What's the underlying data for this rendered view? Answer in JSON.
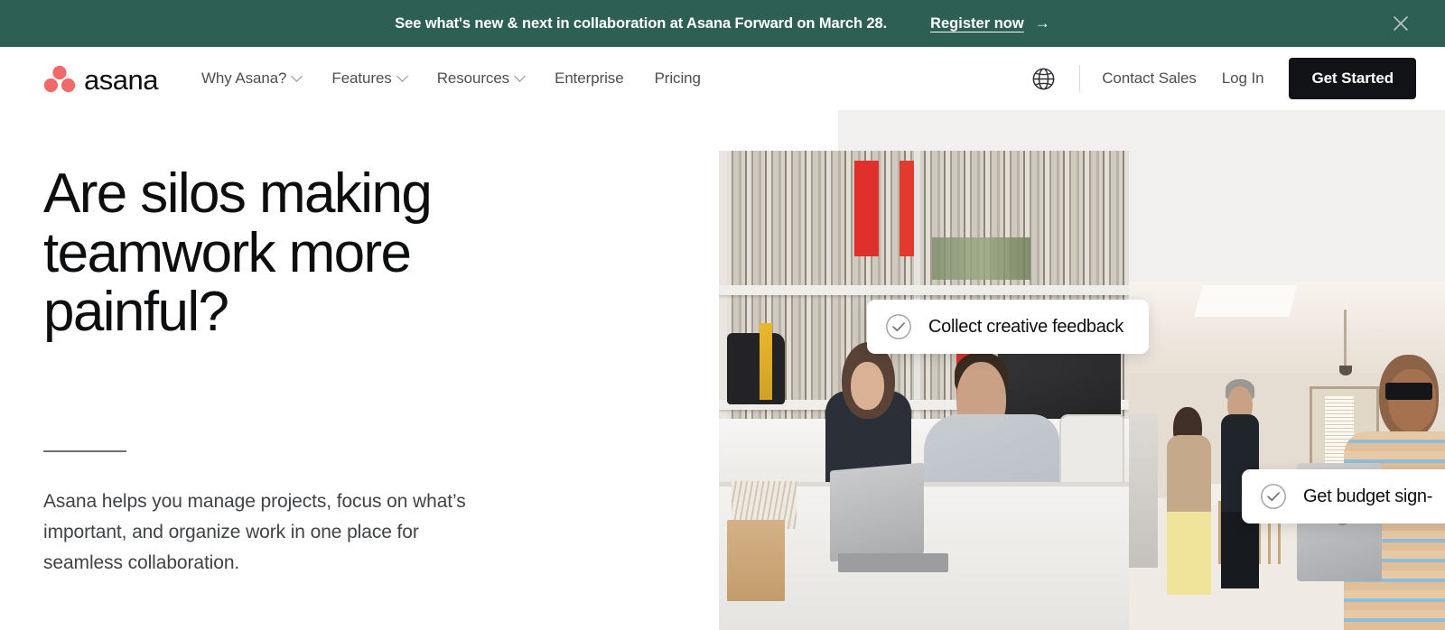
{
  "colors": {
    "banner_bg": "#2e5f55",
    "logo_coral": "#f06a6a",
    "cta_button_bg": "#121316",
    "panel_gray": "#f1f0ee",
    "text_dark": "#0d0e10",
    "text_muted": "#4b4f54"
  },
  "banner": {
    "message": "See what's new & next in collaboration at Asana Forward on March 28.",
    "cta_label": "Register now",
    "cta_arrow": "→",
    "close_icon": "close-icon"
  },
  "nav": {
    "logo": {
      "wordmark": "asana",
      "mark_icon": "asana-dots-logo"
    },
    "links": [
      {
        "label": "Why Asana?",
        "has_dropdown": true
      },
      {
        "label": "Features",
        "has_dropdown": true
      },
      {
        "label": "Resources",
        "has_dropdown": true
      },
      {
        "label": "Enterprise",
        "has_dropdown": false
      },
      {
        "label": "Pricing",
        "has_dropdown": false
      }
    ],
    "language_icon": "globe-icon",
    "contact_sales": "Contact Sales",
    "log_in": "Log In",
    "get_started": "Get Started"
  },
  "hero": {
    "title_lines": [
      "Are silos making",
      "teamwork more",
      "painful?"
    ],
    "title": "Are silos making teamwork more painful?",
    "body": "Asana helps you manage projects, focus on what’s important, and organize work in one place for seamless collaboration.",
    "cards": [
      {
        "label": "Collect creative feedback",
        "icon": "check-circle-icon"
      },
      {
        "label": "Get budget sign-",
        "icon": "check-circle-icon"
      }
    ],
    "photos": [
      {
        "alt": "two-colleagues-at-studio-desk-with-laptop"
      },
      {
        "alt": "showroom-team-woman-holding-laptop"
      }
    ]
  }
}
